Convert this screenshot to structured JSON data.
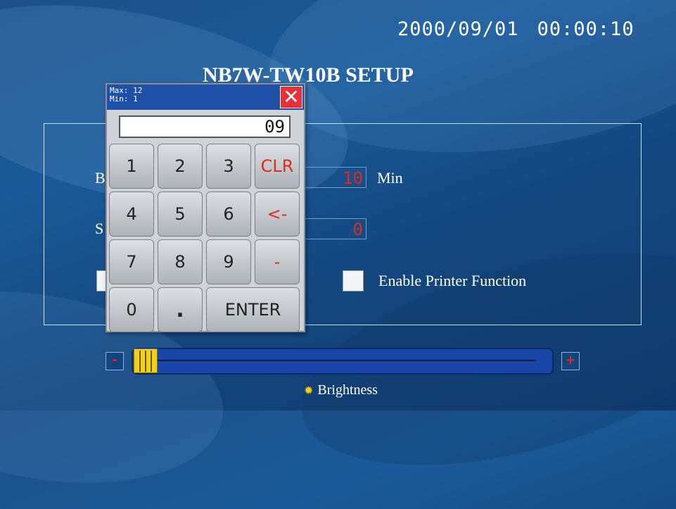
{
  "status_bar": {
    "date": "2000/09/01",
    "time": "00:00:10"
  },
  "title": "NB7W-TW10B SETUP",
  "settings": {
    "row1_label": "B",
    "row1_value": "10",
    "row1_unit": "Min",
    "row2_label": "S",
    "row2_value": "0",
    "printer_label": "Enable Printer Function"
  },
  "brightness": {
    "minus": "-",
    "plus": "+",
    "label": "Brightness",
    "level_fraction": 0.03
  },
  "keypad": {
    "max": "Max: 12",
    "min": "Min: 1",
    "display": "09",
    "close": "✕",
    "keys": [
      "1",
      "2",
      "3",
      "CLR",
      "4",
      "5",
      "6",
      "<-",
      "7",
      "8",
      "9",
      "-",
      "0",
      ".",
      "ENTER"
    ]
  },
  "colors": {
    "accent_red": "#e0291f",
    "slider_thumb": "#f3d11a",
    "title_bar": "#1f50a8"
  }
}
